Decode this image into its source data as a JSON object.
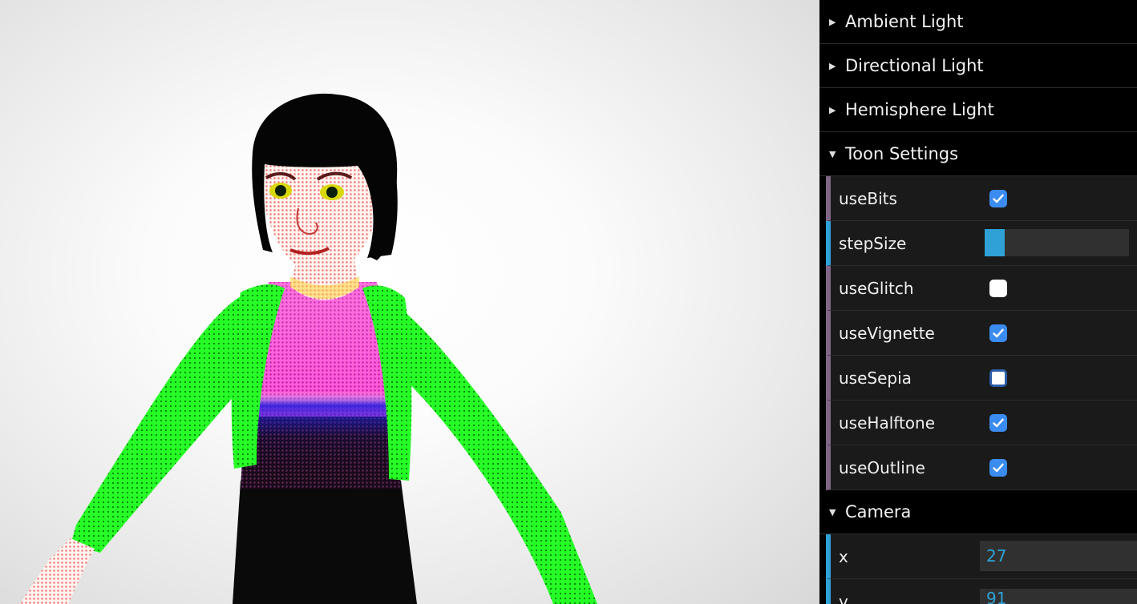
{
  "gui": {
    "folders": {
      "ambient": "Ambient Light",
      "directional": "Directional Light",
      "hemisphere": "Hemisphere Light",
      "toon": "Toon Settings",
      "camera": "Camera"
    },
    "toon": {
      "useBits": {
        "label": "useBits",
        "checked": true
      },
      "stepSize": {
        "label": "stepSize",
        "fraction": 0.14
      },
      "useGlitch": {
        "label": "useGlitch",
        "checked": false
      },
      "useVignette": {
        "label": "useVignette",
        "checked": true
      },
      "useSepia": {
        "label": "useSepia",
        "checked": false
      },
      "useHalftone": {
        "label": "useHalftone",
        "checked": true
      },
      "useOutline": {
        "label": "useOutline",
        "checked": true
      }
    },
    "camera": {
      "x": {
        "label": "x",
        "value": "27"
      },
      "y": {
        "label": "y",
        "value": "91"
      }
    }
  },
  "colors": {
    "accent_blue": "#2fa1d6",
    "checkbox_blue": "#3b8cf0",
    "boolean_border": "#806787",
    "jacket_green": "#22ff22",
    "top_magenta": "#e33ce0"
  }
}
